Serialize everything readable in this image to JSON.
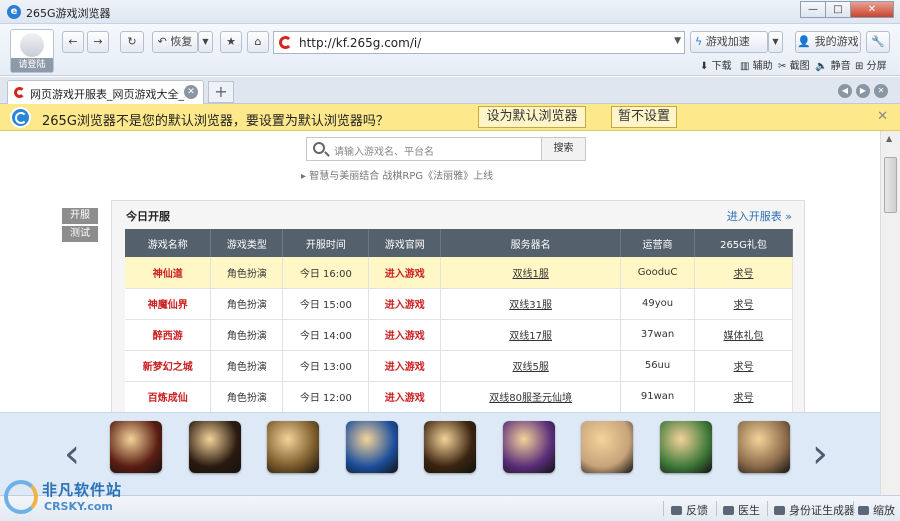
{
  "window": {
    "title": "265G游戏浏览器",
    "controls": {
      "minimize": "—",
      "maximize": "□",
      "close": "✕"
    }
  },
  "toolbar": {
    "login_label": "请登陆",
    "restore_label": "恢复",
    "address_url": "http://kf.265g.com/i/",
    "game_accel_label": "游戏加速",
    "my_games_label": "我的游戏",
    "sub_items": [
      "下载",
      "辅助",
      "截图",
      "静音",
      "分屏"
    ]
  },
  "tabs": [
    {
      "label": "网页游戏开服表_网页游戏大全_2..."
    }
  ],
  "notice": {
    "text": "265G浏览器不是您的默认浏览器，要设置为默认浏览器吗？",
    "set_default_label": "设为默认浏览器",
    "not_now_label": "暂不设置"
  },
  "search": {
    "placeholder": "请输入游戏名、平台名",
    "button_label": "搜索"
  },
  "tagline": "▸ 智慧与美丽结合 战棋RPG《法丽雅》上线",
  "side_buttons": [
    "开服",
    "测试"
  ],
  "panel": {
    "title": "今日开服",
    "more_link": "进入开服表 »",
    "columns": [
      "游戏名称",
      "游戏类型",
      "开服时间",
      "游戏官网",
      "服务器名",
      "运营商",
      "265G礼包"
    ],
    "rows": [
      [
        "神仙道",
        "角色扮演",
        "今日 16:00",
        "进入游戏",
        "双线1服",
        "GooduC",
        "求号"
      ],
      [
        "神魔仙界",
        "角色扮演",
        "今日 15:00",
        "进入游戏",
        "双线31服",
        "49you",
        "求号"
      ],
      [
        "醉西游",
        "角色扮演",
        "今日 14:00",
        "进入游戏",
        "双线17服",
        "37wan",
        "媒体礼包"
      ],
      [
        "新梦幻之城",
        "角色扮演",
        "今日 13:00",
        "进入游戏",
        "双线5服",
        "56uu",
        "求号"
      ],
      [
        "百炼成仙",
        "角色扮演",
        "今日 12:00",
        "进入游戏",
        "双线80服圣元仙境",
        "91wan",
        "求号"
      ]
    ]
  },
  "games_strip": {
    "prev": "‹",
    "next": "›",
    "icons": [
      {
        "name": "game-icon-1",
        "color": "#5a1d12"
      },
      {
        "name": "game-icon-2",
        "color": "#2a1a10"
      },
      {
        "name": "game-icon-3",
        "color": "#7a5a2a"
      },
      {
        "name": "game-icon-4",
        "color": "#1d4f9c"
      },
      {
        "name": "game-icon-5",
        "color": "#3a2410"
      },
      {
        "name": "game-icon-6",
        "color": "#5a2e7a"
      },
      {
        "name": "game-icon-7",
        "color": "#c7a37a"
      },
      {
        "name": "game-icon-8",
        "color": "#3f7a3a"
      },
      {
        "name": "game-icon-9",
        "color": "#8a6a4a"
      }
    ]
  },
  "status": {
    "watermark": "非凡软件站",
    "watermark_sub": "CRSKY.com",
    "items": [
      "反馈",
      "医生",
      "身份证生成器",
      "缩放"
    ]
  }
}
